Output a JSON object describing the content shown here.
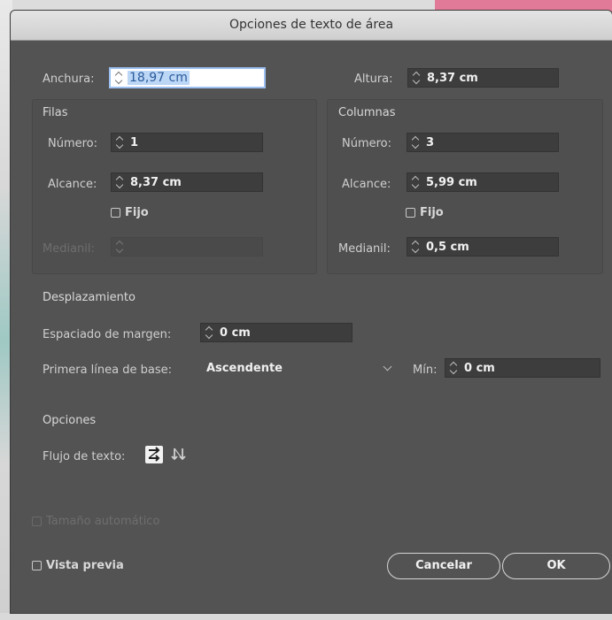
{
  "window": {
    "title": "Opciones de texto de área"
  },
  "size": {
    "width_label": "Anchura:",
    "width_value": "18,97 cm",
    "height_label": "Altura:",
    "height_value": "8,37 cm"
  },
  "rows": {
    "heading": "Filas",
    "number_label": "Número:",
    "number_value": "1",
    "span_label": "Alcance:",
    "span_value": "8,37 cm",
    "fixed_label": "Fijo",
    "gutter_label": "Medianil:",
    "gutter_value": "",
    "gutter_enabled": false
  },
  "columns": {
    "heading": "Columnas",
    "number_label": "Número:",
    "number_value": "3",
    "span_label": "Alcance:",
    "span_value": "5,99 cm",
    "fixed_label": "Fijo",
    "gutter_label": "Medianil:",
    "gutter_value": "0,5 cm"
  },
  "offset": {
    "heading": "Desplazamiento",
    "inset_label": "Espaciado de margen:",
    "inset_value": "0 cm",
    "baseline_label": "Primera línea de base:",
    "baseline_value": "Ascendente",
    "min_label": "Mín:",
    "min_value": "0 cm"
  },
  "options": {
    "heading": "Opciones",
    "flow_label": "Flujo de texto:",
    "flow_icons": [
      "text-flow-by-rows-icon",
      "text-flow-by-columns-icon"
    ],
    "selected_flow": 0
  },
  "auto_size": {
    "label": "Tamaño automático",
    "enabled": false
  },
  "preview": {
    "label": "Vista previa",
    "checked": false
  },
  "buttons": {
    "cancel": "Cancelar",
    "ok": "OK"
  }
}
